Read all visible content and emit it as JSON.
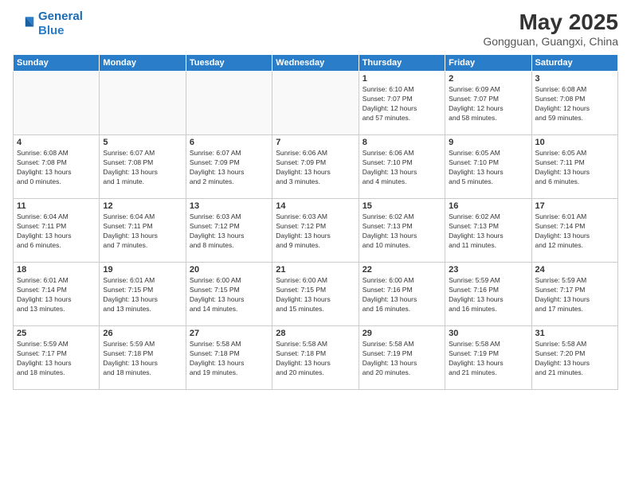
{
  "logo": {
    "line1": "General",
    "line2": "Blue"
  },
  "title": "May 2025",
  "location": "Gongguan, Guangxi, China",
  "weekdays": [
    "Sunday",
    "Monday",
    "Tuesday",
    "Wednesday",
    "Thursday",
    "Friday",
    "Saturday"
  ],
  "weeks": [
    [
      {
        "day": "",
        "info": ""
      },
      {
        "day": "",
        "info": ""
      },
      {
        "day": "",
        "info": ""
      },
      {
        "day": "",
        "info": ""
      },
      {
        "day": "1",
        "info": "Sunrise: 6:10 AM\nSunset: 7:07 PM\nDaylight: 12 hours\nand 57 minutes."
      },
      {
        "day": "2",
        "info": "Sunrise: 6:09 AM\nSunset: 7:07 PM\nDaylight: 12 hours\nand 58 minutes."
      },
      {
        "day": "3",
        "info": "Sunrise: 6:08 AM\nSunset: 7:08 PM\nDaylight: 12 hours\nand 59 minutes."
      }
    ],
    [
      {
        "day": "4",
        "info": "Sunrise: 6:08 AM\nSunset: 7:08 PM\nDaylight: 13 hours\nand 0 minutes."
      },
      {
        "day": "5",
        "info": "Sunrise: 6:07 AM\nSunset: 7:08 PM\nDaylight: 13 hours\nand 1 minute."
      },
      {
        "day": "6",
        "info": "Sunrise: 6:07 AM\nSunset: 7:09 PM\nDaylight: 13 hours\nand 2 minutes."
      },
      {
        "day": "7",
        "info": "Sunrise: 6:06 AM\nSunset: 7:09 PM\nDaylight: 13 hours\nand 3 minutes."
      },
      {
        "day": "8",
        "info": "Sunrise: 6:06 AM\nSunset: 7:10 PM\nDaylight: 13 hours\nand 4 minutes."
      },
      {
        "day": "9",
        "info": "Sunrise: 6:05 AM\nSunset: 7:10 PM\nDaylight: 13 hours\nand 5 minutes."
      },
      {
        "day": "10",
        "info": "Sunrise: 6:05 AM\nSunset: 7:11 PM\nDaylight: 13 hours\nand 6 minutes."
      }
    ],
    [
      {
        "day": "11",
        "info": "Sunrise: 6:04 AM\nSunset: 7:11 PM\nDaylight: 13 hours\nand 6 minutes."
      },
      {
        "day": "12",
        "info": "Sunrise: 6:04 AM\nSunset: 7:11 PM\nDaylight: 13 hours\nand 7 minutes."
      },
      {
        "day": "13",
        "info": "Sunrise: 6:03 AM\nSunset: 7:12 PM\nDaylight: 13 hours\nand 8 minutes."
      },
      {
        "day": "14",
        "info": "Sunrise: 6:03 AM\nSunset: 7:12 PM\nDaylight: 13 hours\nand 9 minutes."
      },
      {
        "day": "15",
        "info": "Sunrise: 6:02 AM\nSunset: 7:13 PM\nDaylight: 13 hours\nand 10 minutes."
      },
      {
        "day": "16",
        "info": "Sunrise: 6:02 AM\nSunset: 7:13 PM\nDaylight: 13 hours\nand 11 minutes."
      },
      {
        "day": "17",
        "info": "Sunrise: 6:01 AM\nSunset: 7:14 PM\nDaylight: 13 hours\nand 12 minutes."
      }
    ],
    [
      {
        "day": "18",
        "info": "Sunrise: 6:01 AM\nSunset: 7:14 PM\nDaylight: 13 hours\nand 13 minutes."
      },
      {
        "day": "19",
        "info": "Sunrise: 6:01 AM\nSunset: 7:15 PM\nDaylight: 13 hours\nand 13 minutes."
      },
      {
        "day": "20",
        "info": "Sunrise: 6:00 AM\nSunset: 7:15 PM\nDaylight: 13 hours\nand 14 minutes."
      },
      {
        "day": "21",
        "info": "Sunrise: 6:00 AM\nSunset: 7:15 PM\nDaylight: 13 hours\nand 15 minutes."
      },
      {
        "day": "22",
        "info": "Sunrise: 6:00 AM\nSunset: 7:16 PM\nDaylight: 13 hours\nand 16 minutes."
      },
      {
        "day": "23",
        "info": "Sunrise: 5:59 AM\nSunset: 7:16 PM\nDaylight: 13 hours\nand 16 minutes."
      },
      {
        "day": "24",
        "info": "Sunrise: 5:59 AM\nSunset: 7:17 PM\nDaylight: 13 hours\nand 17 minutes."
      }
    ],
    [
      {
        "day": "25",
        "info": "Sunrise: 5:59 AM\nSunset: 7:17 PM\nDaylight: 13 hours\nand 18 minutes."
      },
      {
        "day": "26",
        "info": "Sunrise: 5:59 AM\nSunset: 7:18 PM\nDaylight: 13 hours\nand 18 minutes."
      },
      {
        "day": "27",
        "info": "Sunrise: 5:58 AM\nSunset: 7:18 PM\nDaylight: 13 hours\nand 19 minutes."
      },
      {
        "day": "28",
        "info": "Sunrise: 5:58 AM\nSunset: 7:18 PM\nDaylight: 13 hours\nand 20 minutes."
      },
      {
        "day": "29",
        "info": "Sunrise: 5:58 AM\nSunset: 7:19 PM\nDaylight: 13 hours\nand 20 minutes."
      },
      {
        "day": "30",
        "info": "Sunrise: 5:58 AM\nSunset: 7:19 PM\nDaylight: 13 hours\nand 21 minutes."
      },
      {
        "day": "31",
        "info": "Sunrise: 5:58 AM\nSunset: 7:20 PM\nDaylight: 13 hours\nand 21 minutes."
      }
    ]
  ]
}
